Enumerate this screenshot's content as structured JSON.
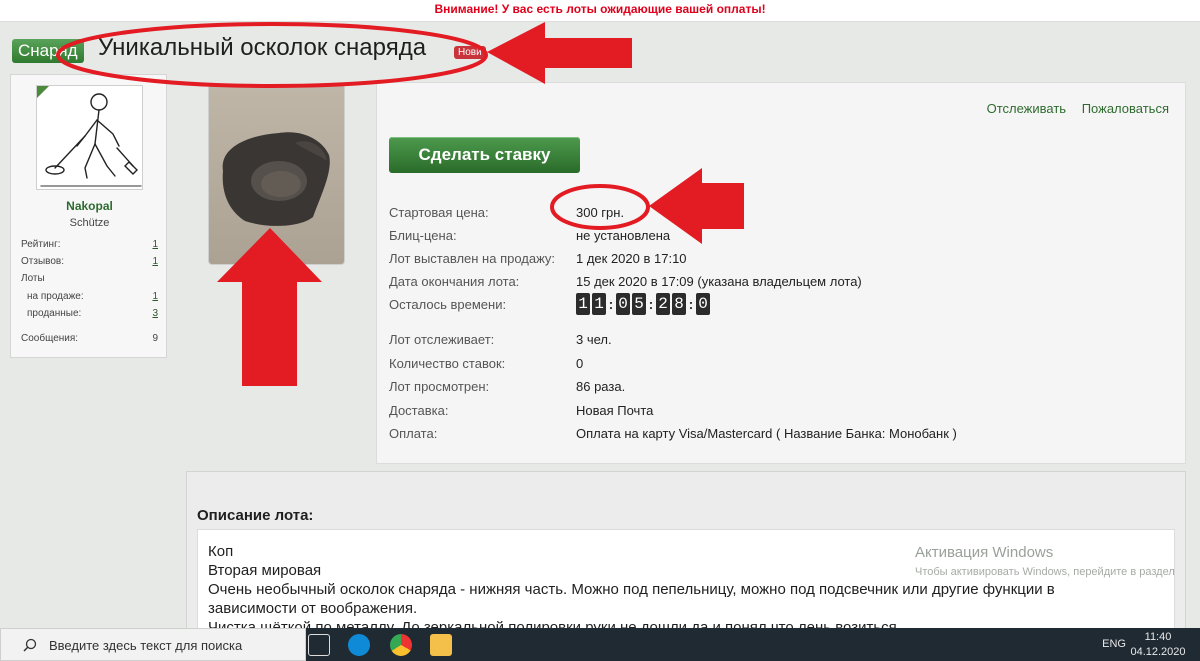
{
  "notice": "Внимание! У вас есть лоты ожидающие вашей оплаты!",
  "thread": {
    "prefix": "Снаряд",
    "title": "Уникальный осколок снаряда",
    "badge": "Новй"
  },
  "user": {
    "name": "Nakopal",
    "title": "Schütze",
    "stats": [
      {
        "label": "Рейтинг:",
        "value": "1"
      },
      {
        "label": "Отзывов:",
        "value": "1"
      },
      {
        "label": "Лоты",
        "value": ""
      },
      {
        "label": "на продаже:",
        "value": "1"
      },
      {
        "label": "проданные:",
        "value": "3"
      },
      {
        "label": "Сообщения:",
        "value": "9"
      }
    ]
  },
  "links": {
    "watch": "Отслеживать",
    "report": "Пожаловаться"
  },
  "bid_button": "Сделать ставку",
  "details": [
    {
      "label": "Стартовая цена:",
      "value": "300 грн."
    },
    {
      "label": "Блиц-цена:",
      "value": "не установлена"
    },
    {
      "label": "Лот выставлен на продажу:",
      "value": "1 дек 2020 в 17:10"
    },
    {
      "label": "Дата окончания лота:",
      "value": "15 дек 2020 в 17:09 (указана владельцем лота)"
    },
    {
      "label": "Осталось времени:",
      "value": ""
    },
    {
      "label": "Лот отслеживает:",
      "value": "3 чел."
    },
    {
      "label": "Количество ставок:",
      "value": "0"
    },
    {
      "label": "Лот просмотрен:",
      "value": "86 раза."
    },
    {
      "label": "Доставка:",
      "value": "Новая Почта"
    },
    {
      "label": "Оплата:",
      "value": "Оплата на карту Visa/Mastercard ( Название Банка: Монобанк )"
    }
  ],
  "timer": {
    "d1": "1",
    "d2": "1",
    "d3": "0",
    "d4": "5",
    "d5": "2",
    "d6": "8",
    "d7": "0"
  },
  "description": {
    "title": "Описание лота:",
    "lines": [
      "Коп",
      "Вторая мировая",
      "Очень необычный осколок снаряда - нижняя часть. Можно под пепельницу, можно под подсвечник или другие функции в",
      "зависимости от воображения.",
      "Чистка щёткой по металлу. До зеркальной полировки руки не дошли да и понял что лень возиться"
    ]
  },
  "watermark": {
    "title": "Активация Windows",
    "subtitle": "Чтобы активировать Windows, перейдите в раздел"
  },
  "taskbar": {
    "search_placeholder": "Введите здесь текст для поиска",
    "lang": "ENG",
    "time": "11:40",
    "date": "04.12.2020"
  },
  "colors": {
    "accent_green": "#2f6b2f",
    "annotation_red": "#e31b23",
    "notice_red": "#e0001b"
  }
}
